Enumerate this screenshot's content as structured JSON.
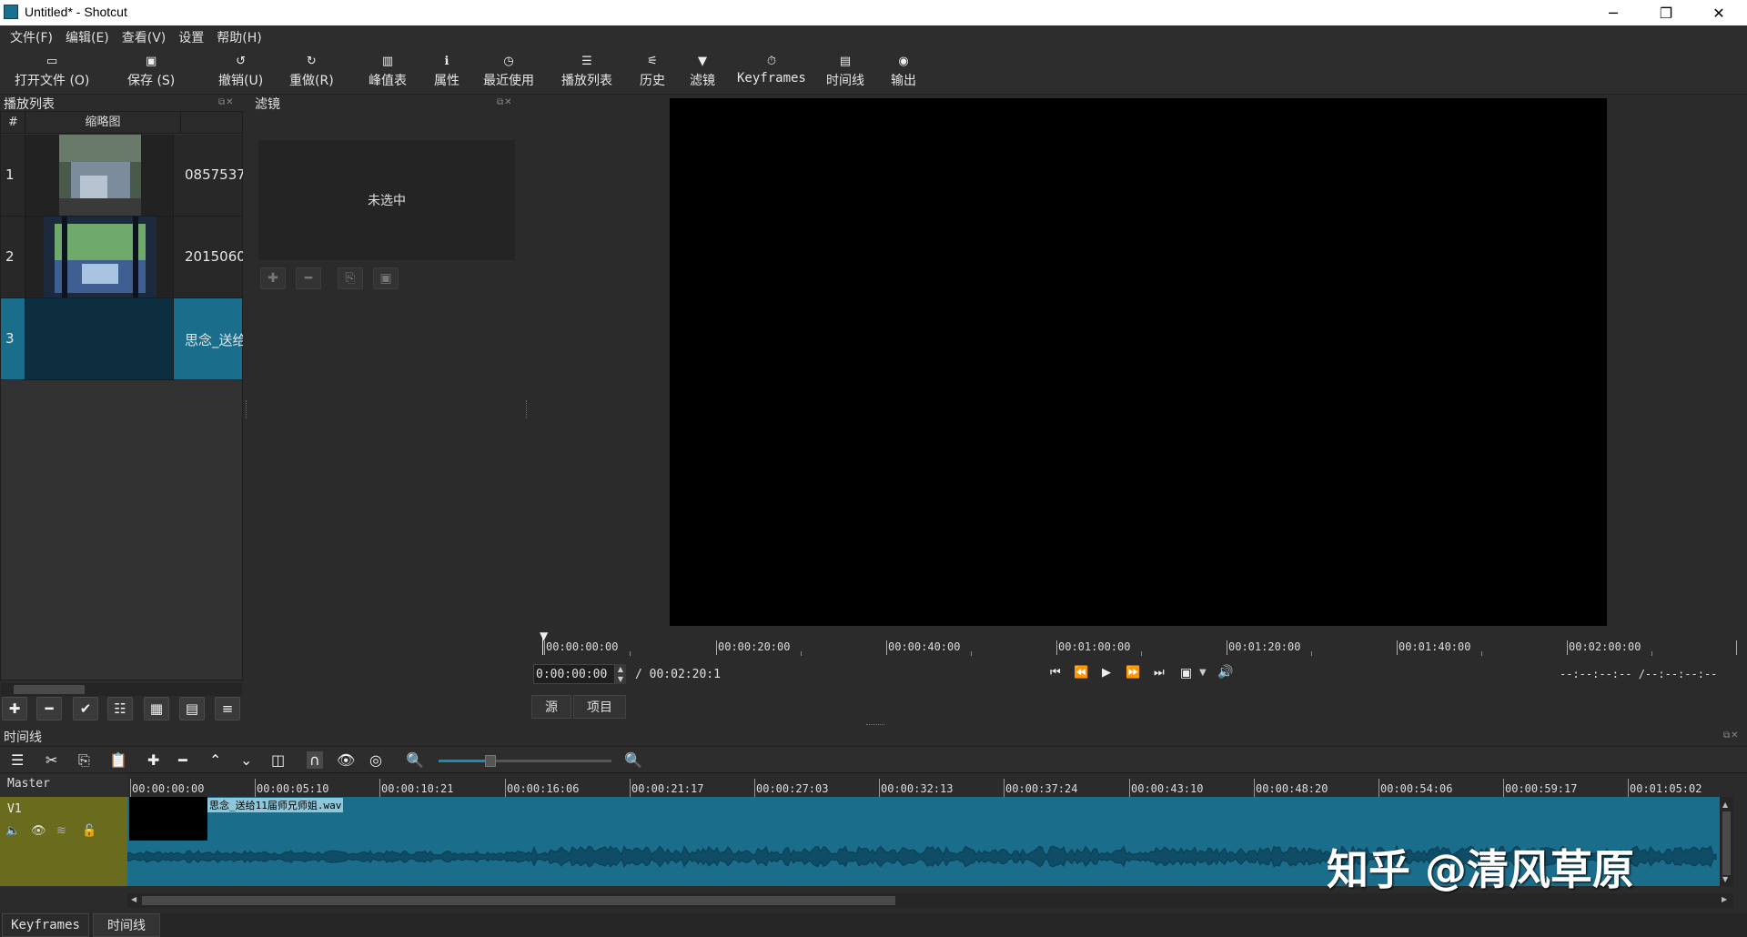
{
  "window": {
    "title": "Untitled* - Shotcut",
    "minimize": "─",
    "maximize": "❐",
    "close": "✕"
  },
  "menu": [
    "文件(F)",
    "编辑(E)",
    "查看(V)",
    "设置",
    "帮助(H)"
  ],
  "toolbar": {
    "open": "打开文件 (O)",
    "save": "保存 (S)",
    "undo": "撤销(U)",
    "redo": "重做(R)",
    "peak_meter": "峰值表",
    "properties": "属性",
    "recent": "最近使用",
    "playlist": "播放列表",
    "history": "历史",
    "filters": "滤镜",
    "keyframes": "Keyframes",
    "timeline": "时间线",
    "export": "输出"
  },
  "playlist": {
    "title": "播放列表",
    "col_num": "#",
    "col_thumb": "缩略图",
    "items": [
      {
        "num": "1",
        "name": "0857537"
      },
      {
        "num": "2",
        "name": "2015060"
      },
      {
        "num": "3",
        "name": "思念_送给"
      }
    ]
  },
  "filters": {
    "title": "滤镜",
    "empty_text": "未选中"
  },
  "viewer": {
    "ruler": [
      "00:00:00:00",
      "00:00:20:00",
      "00:00:40:00",
      "00:01:00:00",
      "00:01:20:00",
      "00:01:40:00",
      "00:02:00:00"
    ],
    "position": "0:00:00:00",
    "duration": "/ 00:02:20:1",
    "in_out": "--:--:--:-- /--:--:--:--",
    "tab_source": "源",
    "tab_project": "项目"
  },
  "timeline": {
    "title": "时间线",
    "master": "Master",
    "track": "V1",
    "clip_name": "思念_送给11届师兄师姐.wav",
    "ruler": [
      "00:00:00:00",
      "00:00:05:10",
      "00:00:10:21",
      "00:00:16:06",
      "00:00:21:17",
      "00:00:27:03",
      "00:00:32:13",
      "00:00:37:24",
      "00:00:43:10",
      "00:00:48:20",
      "00:00:54:06",
      "00:00:59:17",
      "00:01:05:02"
    ],
    "zoom_level": 0.3
  },
  "bottom_tabs": [
    "Keyframes",
    "时间线"
  ],
  "watermark": "知乎 @清风草原",
  "colors": {
    "accent": "#1b6d8c",
    "track_header": "#6b6b1e",
    "background": "#2b2b2b"
  }
}
